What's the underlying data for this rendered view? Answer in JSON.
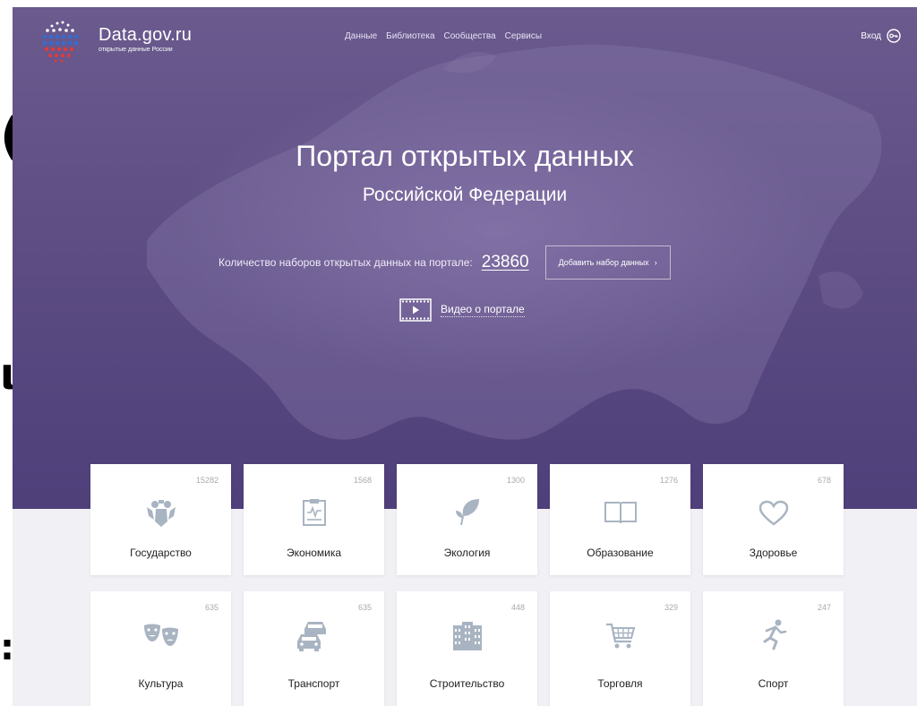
{
  "header": {
    "brand_title": "Data.gov.ru",
    "brand_subtitle": "открытые данные России",
    "nav": [
      "Данные",
      "Библиотека",
      "Сообщества",
      "Сервисы"
    ],
    "login_label": "Вход"
  },
  "hero": {
    "title": "Портал открытых данных",
    "subtitle": "Российской Федерации",
    "count_label": "Количество наборов открытых данных на портале:",
    "count_value": "23860",
    "add_button": "Добавить набор данных",
    "video_label": "Видео о портале"
  },
  "categories": [
    {
      "label": "Государство",
      "count": "15282",
      "icon": "coat-of-arms-icon"
    },
    {
      "label": "Экономика",
      "count": "1568",
      "icon": "clipboard-chart-icon"
    },
    {
      "label": "Экология",
      "count": "1300",
      "icon": "leaf-icon"
    },
    {
      "label": "Образование",
      "count": "1276",
      "icon": "book-icon"
    },
    {
      "label": "Здоровье",
      "count": "678",
      "icon": "heart-icon"
    },
    {
      "label": "Культура",
      "count": "635",
      "icon": "theater-masks-icon"
    },
    {
      "label": "Транспорт",
      "count": "635",
      "icon": "cars-icon"
    },
    {
      "label": "Строительство",
      "count": "448",
      "icon": "building-icon"
    },
    {
      "label": "Торговля",
      "count": "329",
      "icon": "shopping-cart-icon"
    },
    {
      "label": "Спорт",
      "count": "247",
      "icon": "runner-icon"
    }
  ],
  "colors": {
    "hero": "#5f4f85",
    "icon": "#a9b4c2",
    "background": "#f1f1f5"
  }
}
